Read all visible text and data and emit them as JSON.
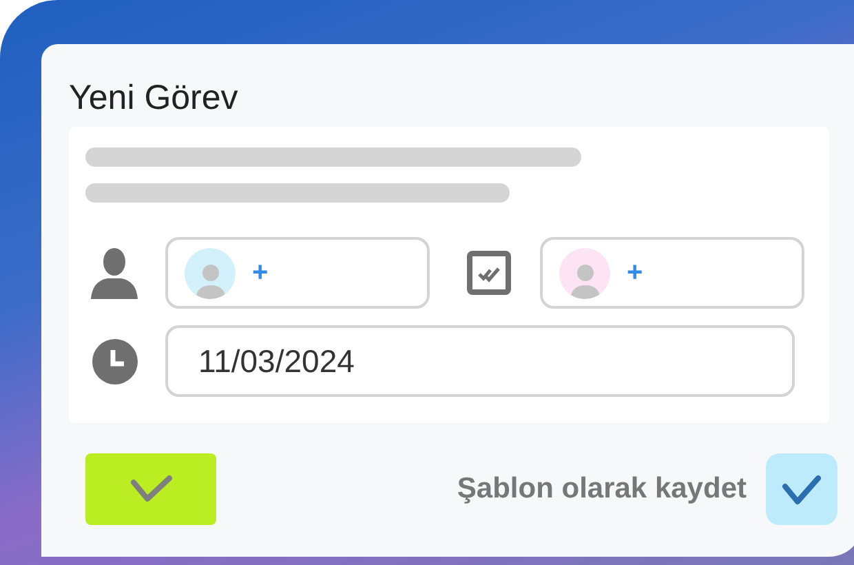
{
  "dialog": {
    "title": "Yeni Görev"
  },
  "assignees": [
    {
      "kind": "person",
      "add_label": "+",
      "color": "#d3f1fb"
    },
    {
      "kind": "task",
      "add_label": "+",
      "color": "#fce4f4"
    }
  ],
  "date": {
    "value": "11/03/2024"
  },
  "confirm_button": {
    "enabled": true
  },
  "save_template": {
    "label": "Şablon olarak kaydet",
    "checked": true
  }
}
